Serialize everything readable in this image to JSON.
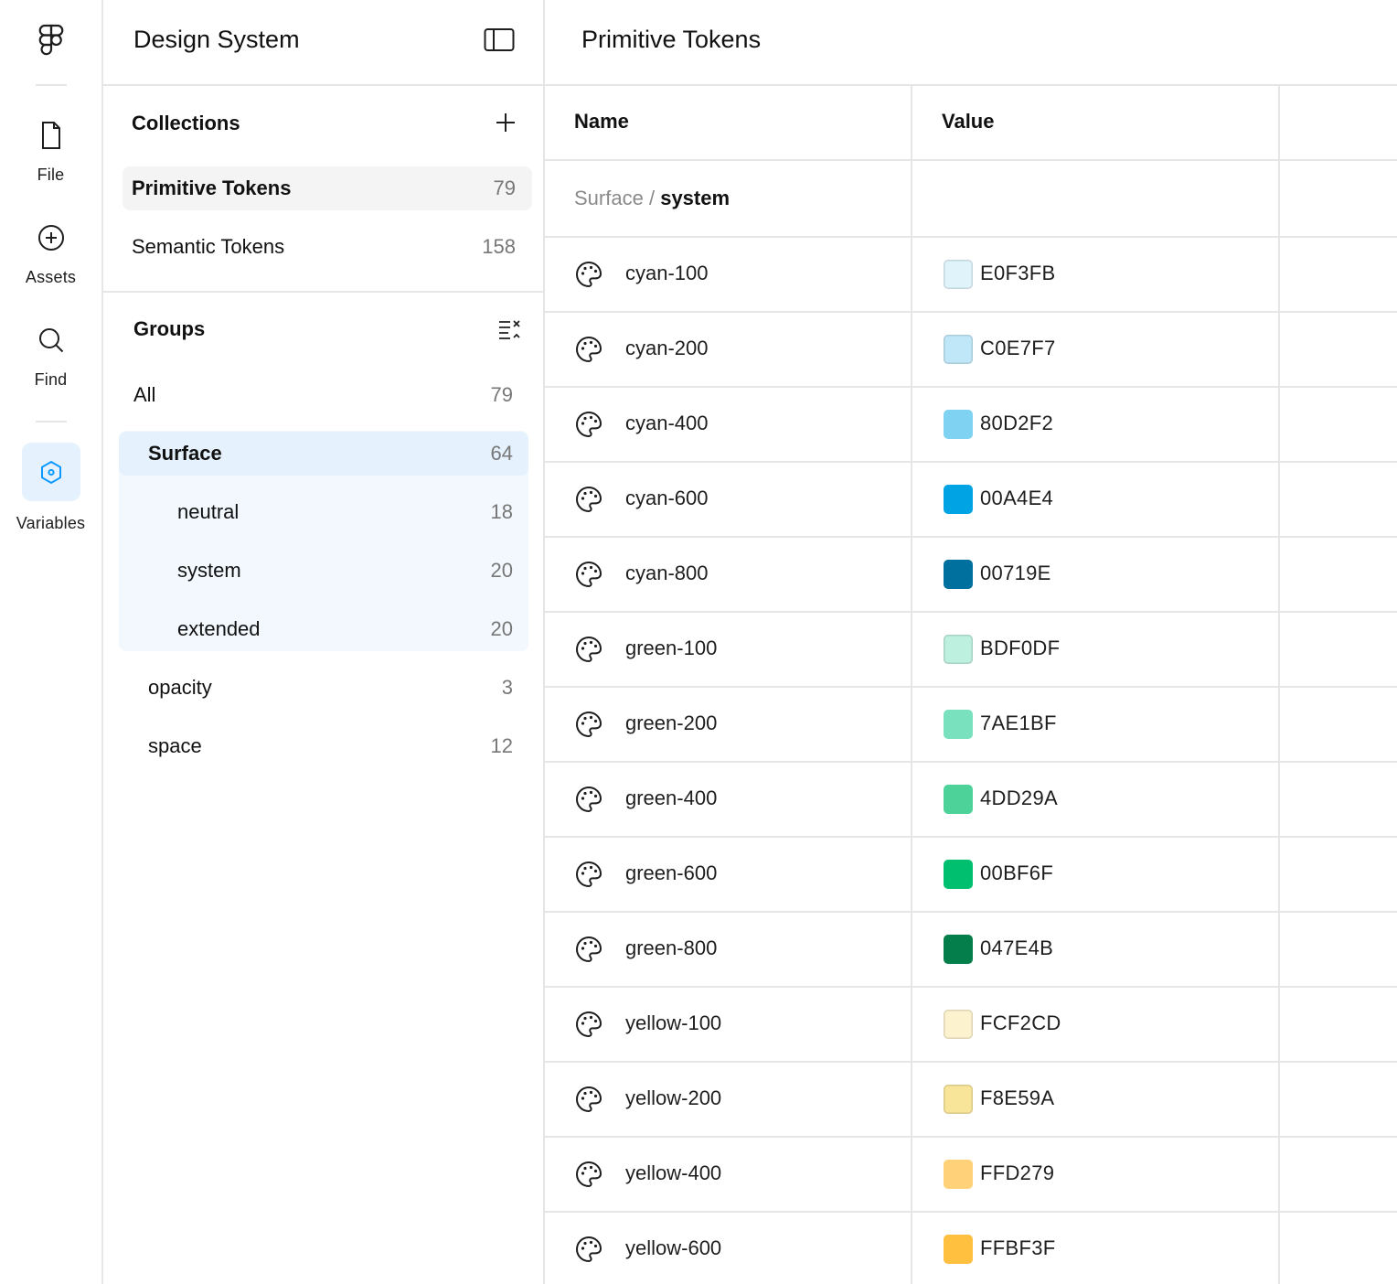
{
  "rail": {
    "items": [
      {
        "label": "File",
        "icon": "file-icon"
      },
      {
        "label": "Assets",
        "icon": "plus-circle-icon"
      },
      {
        "label": "Find",
        "icon": "search-icon"
      },
      {
        "label": "Variables",
        "icon": "variables-icon",
        "active": true
      }
    ]
  },
  "sidebar": {
    "title": "Design System",
    "collections_title": "Collections",
    "collections": [
      {
        "label": "Primitive Tokens",
        "count": "79",
        "selected": true
      },
      {
        "label": "Semantic Tokens",
        "count": "158"
      }
    ],
    "groups_title": "Groups",
    "groups": [
      {
        "label": "All",
        "count": "79"
      },
      {
        "label": "Surface",
        "count": "64",
        "selected": true
      },
      {
        "label": "neutral",
        "count": "18"
      },
      {
        "label": "system",
        "count": "20"
      },
      {
        "label": "extended",
        "count": "20"
      },
      {
        "label": "opacity",
        "count": "3"
      },
      {
        "label": "space",
        "count": "12"
      }
    ]
  },
  "main": {
    "title": "Primitive Tokens",
    "columns": [
      "Name",
      "Value"
    ],
    "breadcrumb": {
      "parent": "Surface",
      "separator": "/",
      "current": "system"
    },
    "rows": [
      {
        "name": "cyan-100",
        "hex": "E0F3FB",
        "color": "#E0F3FB"
      },
      {
        "name": "cyan-200",
        "hex": "C0E7F7",
        "color": "#C0E7F7"
      },
      {
        "name": "cyan-400",
        "hex": "80D2F2",
        "color": "#80D2F2"
      },
      {
        "name": "cyan-600",
        "hex": "00A4E4",
        "color": "#00A4E4"
      },
      {
        "name": "cyan-800",
        "hex": "00719E",
        "color": "#00719E"
      },
      {
        "name": "green-100",
        "hex": "BDF0DF",
        "color": "#BDF0DF"
      },
      {
        "name": "green-200",
        "hex": "7AE1BF",
        "color": "#7AE1BF"
      },
      {
        "name": "green-400",
        "hex": "4DD29A",
        "color": "#4DD29A"
      },
      {
        "name": "green-600",
        "hex": "00BF6F",
        "color": "#00BF6F"
      },
      {
        "name": "green-800",
        "hex": "047E4B",
        "color": "#047E4B"
      },
      {
        "name": "yellow-100",
        "hex": "FCF2CD",
        "color": "#FCF2CD"
      },
      {
        "name": "yellow-200",
        "hex": "F8E59A",
        "color": "#F8E59A"
      },
      {
        "name": "yellow-400",
        "hex": "FFD279",
        "color": "#FFD279"
      },
      {
        "name": "yellow-600",
        "hex": "FFBF3F",
        "color": "#FFBF3F"
      }
    ]
  },
  "colors": {
    "accent": "#0d99ff",
    "selected_bg": "#e5f2fd",
    "border": "#e6e6e6"
  }
}
